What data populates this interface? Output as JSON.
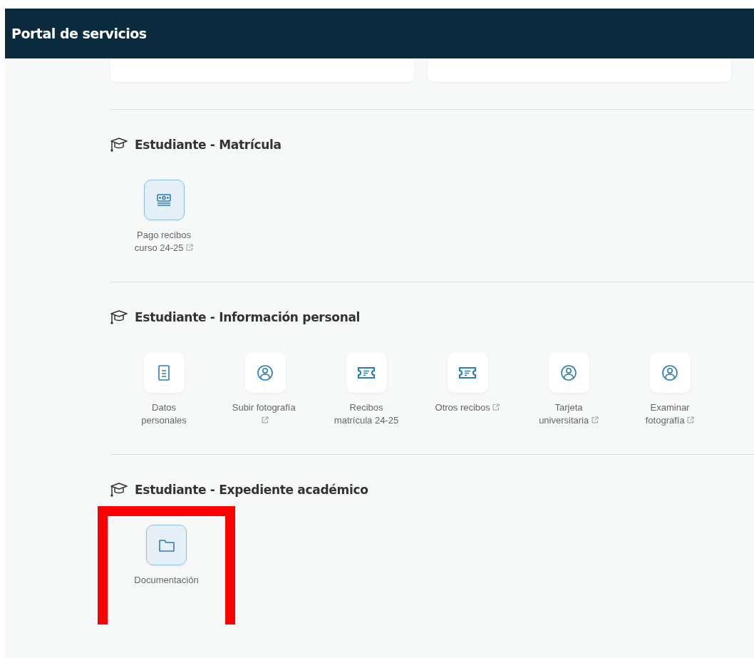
{
  "header": {
    "title": "Portal de servicios"
  },
  "sections": [
    {
      "title": "Estudiante - Matrícula",
      "items": [
        {
          "label": "Pago recibos curso 24-25",
          "kind": "cash",
          "external": true,
          "featured": true,
          "marked": false
        }
      ]
    },
    {
      "title": "Estudiante - Información personal",
      "items": [
        {
          "label": "Datos personales",
          "kind": "document",
          "external": false,
          "featured": false,
          "marked": false
        },
        {
          "label": "Subir fotografía",
          "kind": "user",
          "external": true,
          "featured": false,
          "marked": false
        },
        {
          "label": "Recibos matrícula 24-25",
          "kind": "ticket",
          "external": false,
          "featured": false,
          "marked": false
        },
        {
          "label": "Otros recibos",
          "kind": "ticket",
          "external": true,
          "featured": false,
          "marked": false
        },
        {
          "label": "Tarjeta universitaria",
          "kind": "user",
          "external": true,
          "featured": false,
          "marked": false
        },
        {
          "label": "Examinar fotografía",
          "kind": "user",
          "external": true,
          "featured": false,
          "marked": false
        }
      ]
    },
    {
      "title": "Estudiante - Expediente académico",
      "items": [
        {
          "label": "Documentación",
          "kind": "folder",
          "external": false,
          "featured": true,
          "marked": true
        }
      ]
    }
  ]
}
